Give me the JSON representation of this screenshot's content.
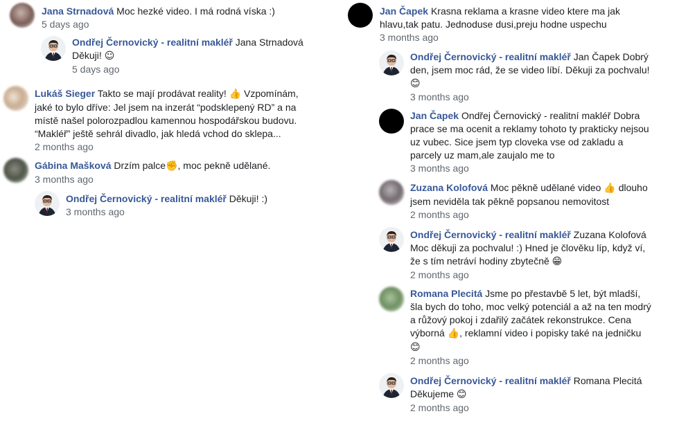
{
  "colors": {
    "author": "#385898",
    "time": "#606770",
    "text": "#1c1e21"
  },
  "icons": {
    "thumbs_up": "👍",
    "smiley": "😊",
    "small_smile": "☺",
    "fist": "✊",
    "grin": "😁"
  },
  "left": {
    "c1": {
      "author": "Jana Strnadová",
      "text": "Moc hezké video. I má rodná víska :)",
      "time": "5 days ago"
    },
    "r1": {
      "author": "Ondřej Černovický - realitní makléř",
      "mention": "Jana Strnadová",
      "text": "Děkuji!",
      "time": "5 days ago"
    },
    "c2": {
      "author": "Lukáš Sieger",
      "text1": "Takto se mají prodávat reality!",
      "text2": "Vzpomínám,",
      "line2": "jaké to bylo dříve: Jel jsem na inzerát “podsklepený RD” a na",
      "line3": "místě našel polorozpadlou kamennou hospodářskou budovu.",
      "line4": "“Makléř” ještě sehrál divadlo, jak hledá vchod do sklepa...",
      "time": "2 months ago"
    },
    "c3": {
      "author": "Gábina Mašková",
      "text1": "Drzím palce",
      "text2": ", moc pekně udělané.",
      "time": "3 months ago"
    },
    "r3": {
      "author": "Ondřej Černovický - realitní makléř",
      "text": "Děkuji! :)",
      "time": "3 months ago"
    }
  },
  "right": {
    "c1": {
      "author": "Jan Čapek",
      "line1": "Krasna reklama a krasne video ktere ma jak",
      "line2": "hlavu,tak patu. Jednoduse dusi,preju hodne uspechu",
      "time": "3 months ago"
    },
    "r1": {
      "author": "Ondřej Černovický - realitní makléř",
      "line1": "Jan Čapek Dobrý",
      "line2": "den, jsem moc rád, že se video líbí. Děkuji za pochvalu!",
      "time": "3 months ago"
    },
    "c2": {
      "author": "Jan Čapek",
      "line1": "Ondřej Černovický - realitní makléř Dobra",
      "line2": "prace se ma ocenit a reklamy tohoto ty prakticky nejsou",
      "line3": "uz vubec. Sice jsem typ cloveka vse od zakladu a",
      "line4": "parcely uz mam,ale zaujalo me to",
      "time": "3 months ago"
    },
    "c3": {
      "author": "Zuzana Kolofová",
      "line1a": "Moc pěkně udělané video",
      "line1b": "dlouho",
      "line2": "jsem neviděla tak pěkně popsanou nemovitost",
      "time": "2 months ago"
    },
    "r3": {
      "author": "Ondřej Černovický - realitní makléř",
      "line1": "Zuzana Kolofová",
      "line2": "Moc děkuji za pochvalu! :) Hned je člověku líp, když ví,",
      "line3": "že s tím netráví hodiny zbytečně",
      "time": "2 months ago"
    },
    "c4": {
      "author": "Romana Plecitá",
      "line1": "Jsme po přestavbě 5 let, být mladší,",
      "line2": "šla bych do toho, moc velký potenciál a až na ten modrý",
      "line3": "a růžový pokoj i zdařilý začátek rekonstrukce. Cena",
      "line4a": "výborná",
      "line4b": ", reklamní video i popisky také na jedničku",
      "time": "2 months ago"
    },
    "r4": {
      "author": "Ondřej Černovický - realitní makléř",
      "line1": "Romana Plecitá",
      "line2": "Děkujeme",
      "time": "2 months ago"
    }
  }
}
